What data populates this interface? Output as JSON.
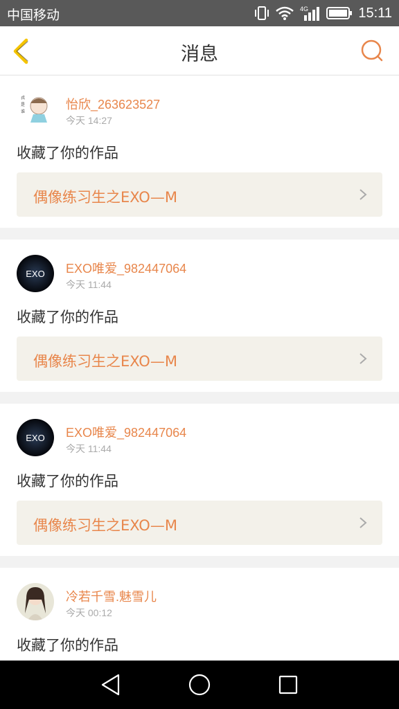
{
  "status_bar": {
    "carrier": "中国移动",
    "network": "4G",
    "time": "15:11"
  },
  "header": {
    "title": "消息",
    "back_icon": "chevron-left-icon",
    "search_icon": "search-icon"
  },
  "colors": {
    "accent": "#e8864b",
    "header_back": "#f5c400",
    "link_bg": "#f3f1ea",
    "status_bar": "#595959"
  },
  "messages": [
    {
      "username": "怡欣_263623527",
      "time": "今天 14:27",
      "action": "收藏了你的作品",
      "work_title": "偶像练习生之EXO—M"
    },
    {
      "username": "EXO唯爱_982447064",
      "time": "今天 11:44",
      "action": "收藏了你的作品",
      "work_title": "偶像练习生之EXO—M"
    },
    {
      "username": "EXO唯爱_982447064",
      "time": "今天 11:44",
      "action": "收藏了你的作品",
      "work_title": "偶像练习生之EXO—M"
    },
    {
      "username": "冷若千雪.魅雪儿",
      "time": "今天 00:12",
      "action": "收藏了你的作品"
    }
  ],
  "avatar_texts": {
    "exo": "EXO"
  }
}
